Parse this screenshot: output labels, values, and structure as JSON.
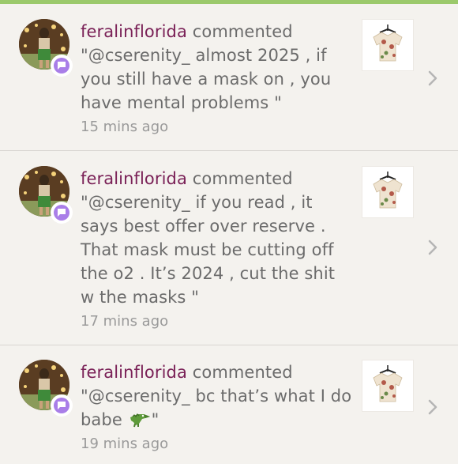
{
  "notifications": [
    {
      "username": "feralinflorida",
      "action": "commented",
      "comment": "\"@cserenity_ almost 2025 , if you still have a mask on , you have mental problems \"",
      "time": "15 mins ago"
    },
    {
      "username": "feralinflorida",
      "action": "commented",
      "comment": "\"@cserenity_ if you read , it says best offer over reserve . That mask must be cutting off the o2 . It’s 2024 , cut the shit w the masks \"",
      "time": "17 mins ago"
    },
    {
      "username": "feralinflorida",
      "action": "commented",
      "comment_before_emoji": "\"@cserenity_ bc that’s what I do babe ",
      "emoji": "crocodile-emoji",
      "comment_after_emoji": "\"",
      "time": "19 mins ago"
    }
  ],
  "colors": {
    "top_bar": "#9bc96b",
    "username": "#7a2157",
    "badge": "#a97ee8",
    "background": "#f4f2ee"
  }
}
